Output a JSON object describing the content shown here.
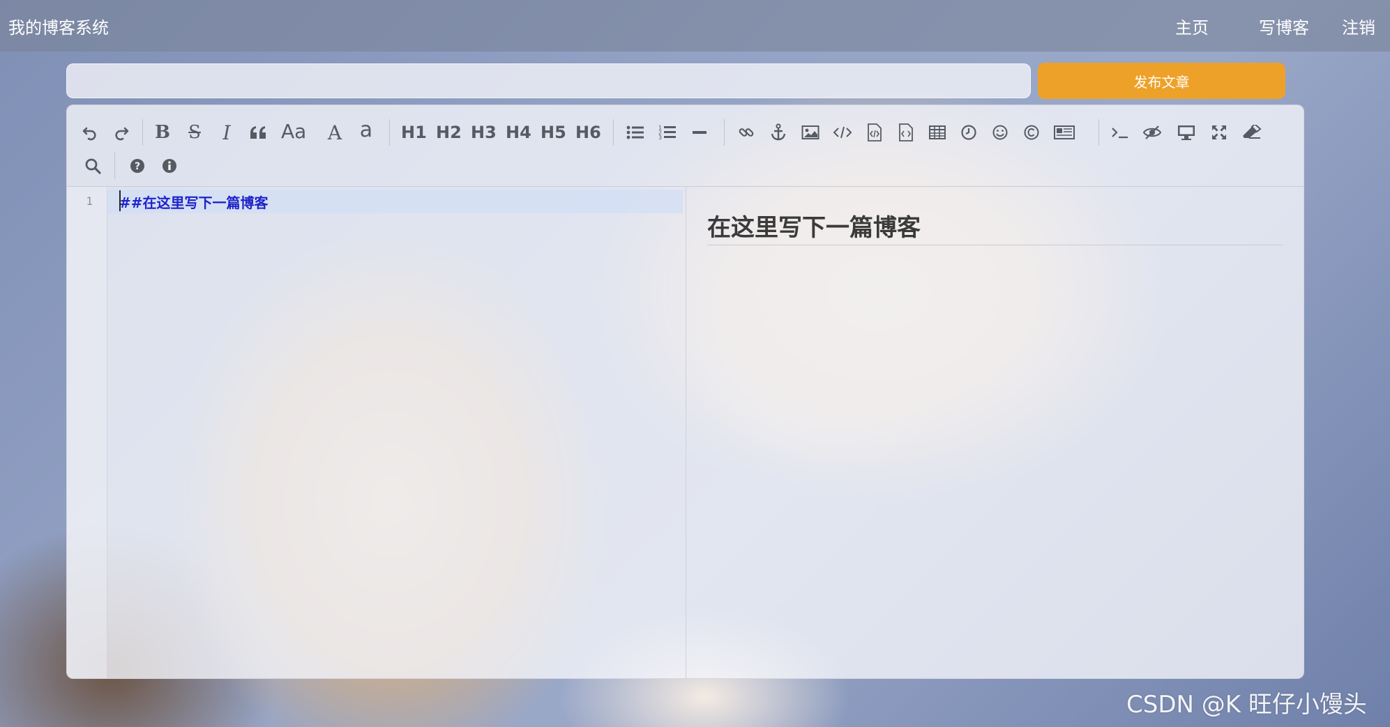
{
  "nav": {
    "brand": "我的博客系统",
    "links": [
      "主页",
      "写博客",
      "注销"
    ]
  },
  "form": {
    "title_value": "",
    "publish_label": "发布文章"
  },
  "toolbar": {
    "icons": [
      "undo-icon",
      "redo-icon",
      "bold-icon",
      "strikethrough-icon",
      "italic-icon",
      "quote-icon",
      "uppercase-icon",
      "font-case-icon",
      "lowercase-icon",
      "h1",
      "h2",
      "h3",
      "h4",
      "h5",
      "h6",
      "unordered-list-icon",
      "ordered-list-icon",
      "horizontal-rule-icon",
      "link-icon",
      "anchor-icon",
      "image-icon",
      "code-icon",
      "code-block-icon",
      "preformatted-icon",
      "table-icon",
      "datetime-icon",
      "emoji-icon",
      "html-entities-icon",
      "pagebreak-icon",
      "goto-line-icon",
      "watch-icon",
      "preview-icon",
      "fullscreen-icon",
      "clear-icon",
      "search-icon",
      "help-icon",
      "info-icon"
    ],
    "text_buttons": {
      "font_case": "Aa",
      "uppercase": "A",
      "lowercase": "a",
      "h1": "H1",
      "h2": "H2",
      "h3": "H3",
      "h4": "H4",
      "h5": "H5",
      "h6": "H6"
    }
  },
  "editor": {
    "line_number": "1",
    "markdown": "##在这里写下一篇博客"
  },
  "preview": {
    "heading": "在这里写下一篇博客"
  },
  "watermark": "CSDN @K 旺仔小馒头",
  "colors": {
    "publish": "#eea128",
    "markdown_text": "#1d23c9",
    "toolbar_icon": "#555a63"
  }
}
